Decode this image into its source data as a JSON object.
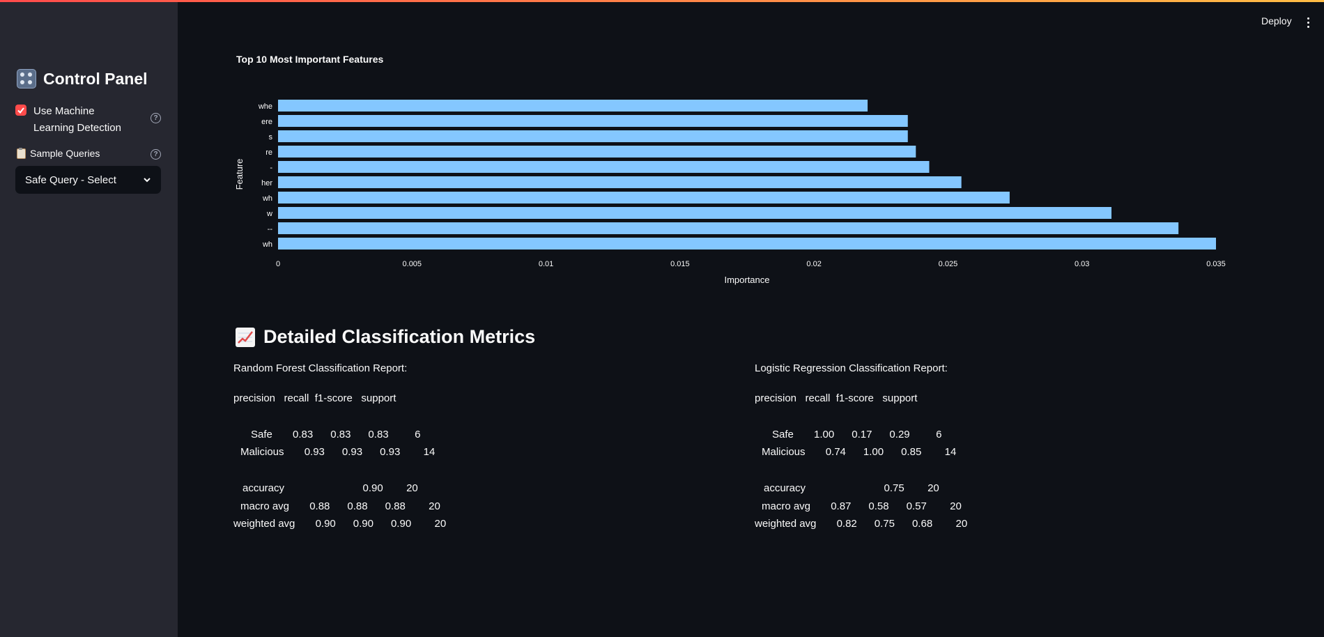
{
  "sidebar": {
    "title": "Control Panel",
    "title_icon": "control-knobs-icon",
    "ml_checkbox": {
      "label": "Use Machine Learning Detection",
      "checked": true
    },
    "sample_label": "Sample Queries",
    "sample_icon": "clipboard-icon",
    "select_value": "Safe Query - Select"
  },
  "header": {
    "deploy_label": "Deploy",
    "menu_icon": "kebab-menu-icon"
  },
  "chart_data": {
    "type": "bar",
    "orientation": "horizontal",
    "title": "Top 10 Most Important Features",
    "xlabel": "Importance",
    "ylabel": "Feature",
    "categories": [
      "whe",
      "ere",
      "s",
      "re",
      "-",
      "her",
      "wh",
      "w",
      "--",
      "wh"
    ],
    "values": [
      0.022,
      0.0235,
      0.0235,
      0.0238,
      0.0243,
      0.0255,
      0.0273,
      0.0311,
      0.0336,
      0.035
    ],
    "xlim": [
      0,
      0.035
    ],
    "xticks": [
      "0",
      "0.005",
      "0.01",
      "0.015",
      "0.02",
      "0.025",
      "0.03",
      "0.035"
    ],
    "bar_color": "#84c7ff"
  },
  "metrics": {
    "title": "Detailed Classification Metrics",
    "title_icon": "chart-increasing-icon",
    "reports": [
      {
        "title": "Random Forest Classification Report:",
        "header": "precision   recall  f1-score   support",
        "lines": [
          "Safe       0.83      0.83      0.83         6",
          "Malicious       0.93      0.93      0.93        14",
          "accuracy                           0.90        20",
          "macro avg       0.88      0.88      0.88        20",
          "weighted avg       0.90      0.90      0.90        20"
        ]
      },
      {
        "title": "Logistic Regression Classification Report:",
        "header": "precision   recall  f1-score   support",
        "lines": [
          "Safe       1.00      0.17      0.29         6",
          "Malicious       0.74      1.00      0.85        14",
          "accuracy                           0.75        20",
          "macro avg       0.87      0.58      0.57        20",
          "weighted avg       0.82      0.75      0.68        20"
        ]
      }
    ]
  }
}
